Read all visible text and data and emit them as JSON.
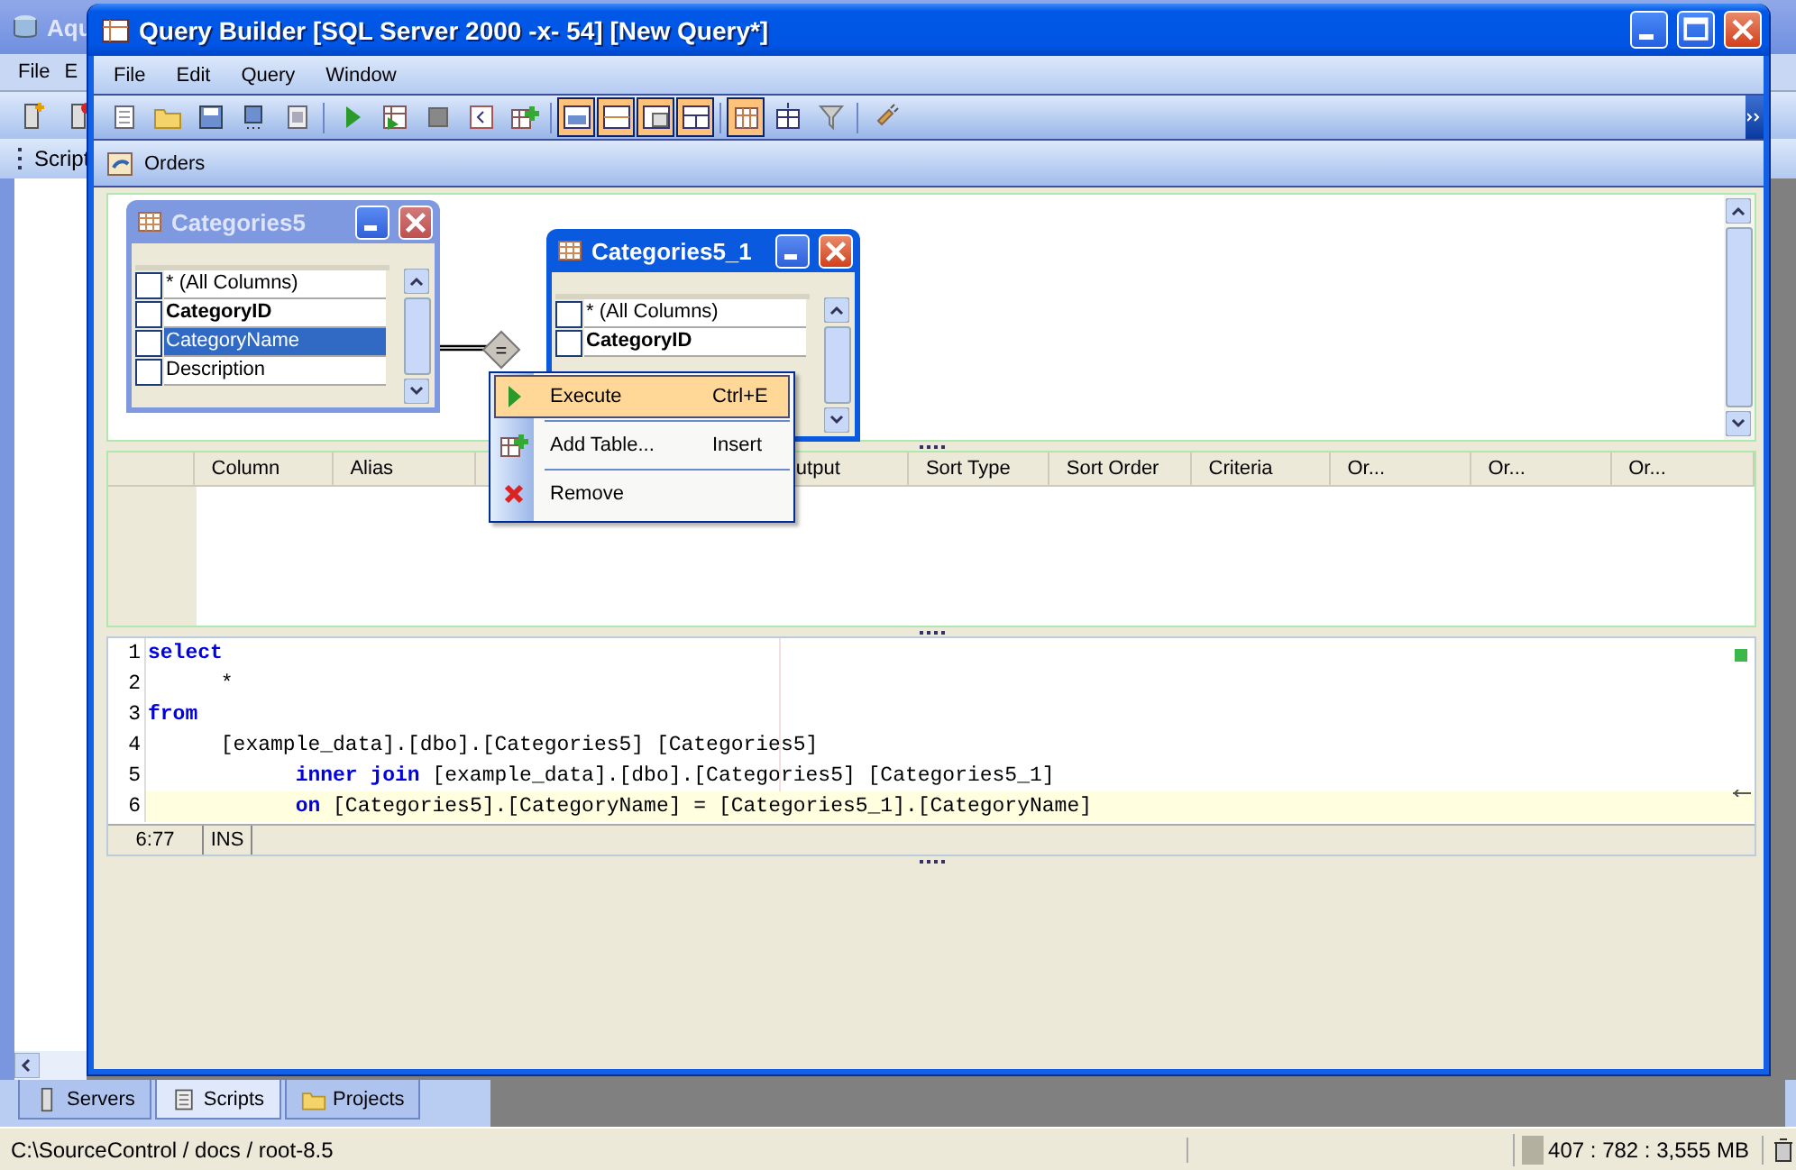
{
  "background_app": {
    "title": "Aqu",
    "menu": [
      "File",
      "E"
    ],
    "panel_title": "Script",
    "tabs": [
      {
        "label": "Servers",
        "selected": false
      },
      {
        "label": "Scripts",
        "selected": true
      },
      {
        "label": "Projects",
        "selected": false
      }
    ],
    "status_bar": {
      "path": "C:\\SourceControl / docs / root-8.5",
      "memory": "407 : 782 : 3,555 MB"
    }
  },
  "window": {
    "title": "Query Builder [SQL Server 2000 -x- 54] [New Query*]",
    "menu": [
      "File",
      "Edit",
      "Query",
      "Window"
    ],
    "toolbar_groups": [
      [
        {
          "on": false
        },
        {
          "on": false
        },
        {
          "on": false
        },
        {
          "on": false
        },
        {
          "on": false
        }
      ],
      [
        {
          "on": false
        },
        {
          "on": false
        },
        {
          "on": false
        },
        {
          "on": false
        },
        {
          "on": false
        }
      ],
      [
        {
          "on": true
        },
        {
          "on": true
        },
        {
          "on": true
        },
        {
          "on": true
        }
      ],
      [
        {
          "on": true
        },
        {
          "on": false
        },
        {
          "on": false
        }
      ],
      [
        {
          "on": false
        }
      ]
    ],
    "document_tab": "Orders"
  },
  "diagram": {
    "tables": [
      {
        "title": "Categories5",
        "active": false,
        "columns": [
          {
            "name": "* (All Columns)",
            "checked": false,
            "key": false,
            "selected": false
          },
          {
            "name": "CategoryID",
            "checked": false,
            "key": true,
            "selected": false
          },
          {
            "name": "CategoryName",
            "checked": false,
            "key": false,
            "selected": true
          },
          {
            "name": "Description",
            "checked": false,
            "key": false,
            "selected": false
          }
        ]
      },
      {
        "title": "Categories5_1",
        "active": true,
        "columns": [
          {
            "name": "* (All Columns)",
            "checked": false,
            "key": false,
            "selected": false
          },
          {
            "name": "CategoryID",
            "checked": false,
            "key": true,
            "selected": false
          }
        ]
      }
    ],
    "join_label": "="
  },
  "context_menu": [
    {
      "label": "Execute",
      "shortcut": "Ctrl+E",
      "selected": true
    },
    {
      "label": "Add Table...",
      "shortcut": "Insert",
      "selected": false
    },
    {
      "label": "Remove",
      "selected": false
    }
  ],
  "grid": {
    "columns": [
      "Column",
      "Alias",
      "utput",
      "Sort Type",
      "Sort Order",
      "Criteria",
      "Or...",
      "Or...",
      "Or..."
    ]
  },
  "editor": {
    "lines": [
      {
        "number": "1",
        "kind": "clause",
        "current": false,
        "segments": [
          {
            "kind": "keyword",
            "text": "select"
          }
        ]
      },
      {
        "number": "2",
        "kind": "item",
        "current": false,
        "segments": [
          {
            "kind": "text",
            "text": "*"
          }
        ]
      },
      {
        "number": "3",
        "kind": "clause",
        "current": false,
        "segments": [
          {
            "kind": "keyword",
            "text": "from"
          }
        ]
      },
      {
        "number": "4",
        "kind": "item",
        "current": false,
        "segments": [
          {
            "kind": "text",
            "text": "[example_data].[dbo].[Categories5] [Categories5]"
          }
        ]
      },
      {
        "number": "5",
        "kind": "nested",
        "current": false,
        "segments": [
          {
            "kind": "keyword",
            "text": "inner join"
          },
          {
            "kind": "text",
            "text": " [example_data].[dbo].[Categories5] [Categories5_1]"
          }
        ]
      },
      {
        "number": "6",
        "kind": "nested",
        "current": true,
        "segments": [
          {
            "kind": "keyword",
            "text": "on"
          },
          {
            "kind": "text",
            "text": " [Categories5].[CategoryName] = [Categories5_1].[CategoryName]"
          }
        ]
      }
    ],
    "position": "6:77",
    "mode": "INS"
  }
}
